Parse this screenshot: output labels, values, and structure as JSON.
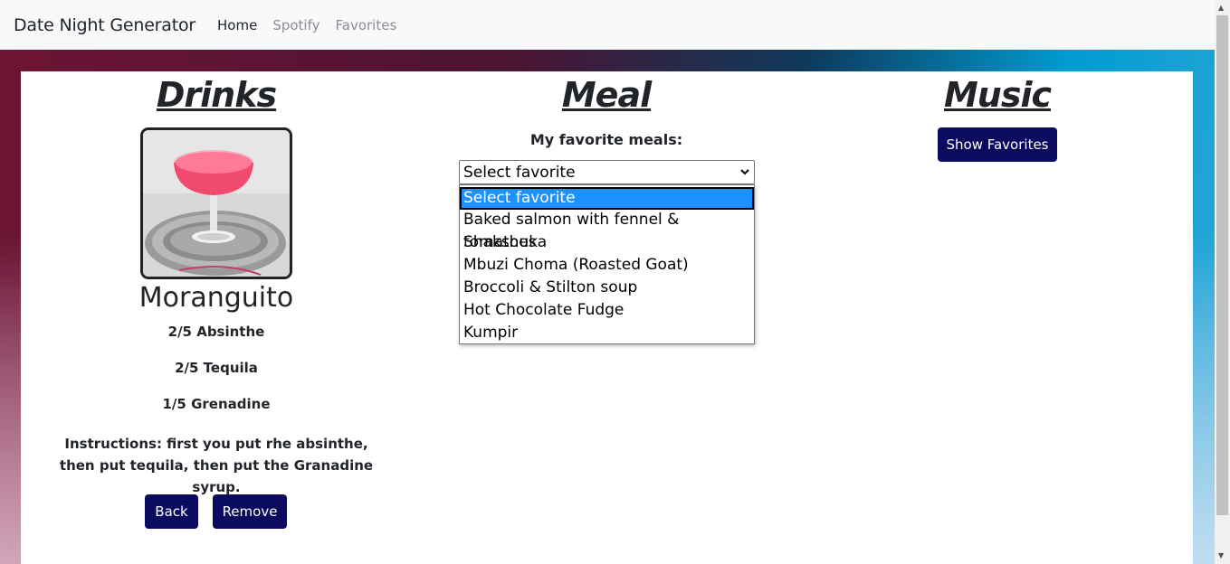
{
  "navbar": {
    "brand": "Date Night Generator",
    "links": [
      {
        "label": "Home",
        "active": true
      },
      {
        "label": "Spotify",
        "active": false
      },
      {
        "label": "Favorites",
        "active": false
      }
    ]
  },
  "columns": {
    "drinks_title": "Drinks",
    "meal_title": "Meal",
    "music_title": "Music"
  },
  "drink": {
    "name": "Moranguito",
    "ingredients": [
      "2/5 Absinthe",
      "2/5 Tequila",
      "1/5 Grenadine"
    ],
    "instructions": "Instructions: first you put rhe absinthe, then put tequila, then put the Granadine syrup.",
    "back_label": "Back",
    "remove_label": "Remove"
  },
  "meal": {
    "label": "My favorite meals:",
    "selected": "Select favorite",
    "options": [
      "Select favorite",
      "Baked salmon with fennel & tomatoes",
      "Shakshuka",
      "Mbuzi Choma (Roasted Goat)",
      "Broccoli & Stilton soup",
      "Hot Chocolate Fudge",
      "Kumpir"
    ]
  },
  "music": {
    "show_favorites_label": "Show Favorites"
  },
  "colors": {
    "button": "#0a0a5e",
    "highlight": "#1e90ff"
  }
}
